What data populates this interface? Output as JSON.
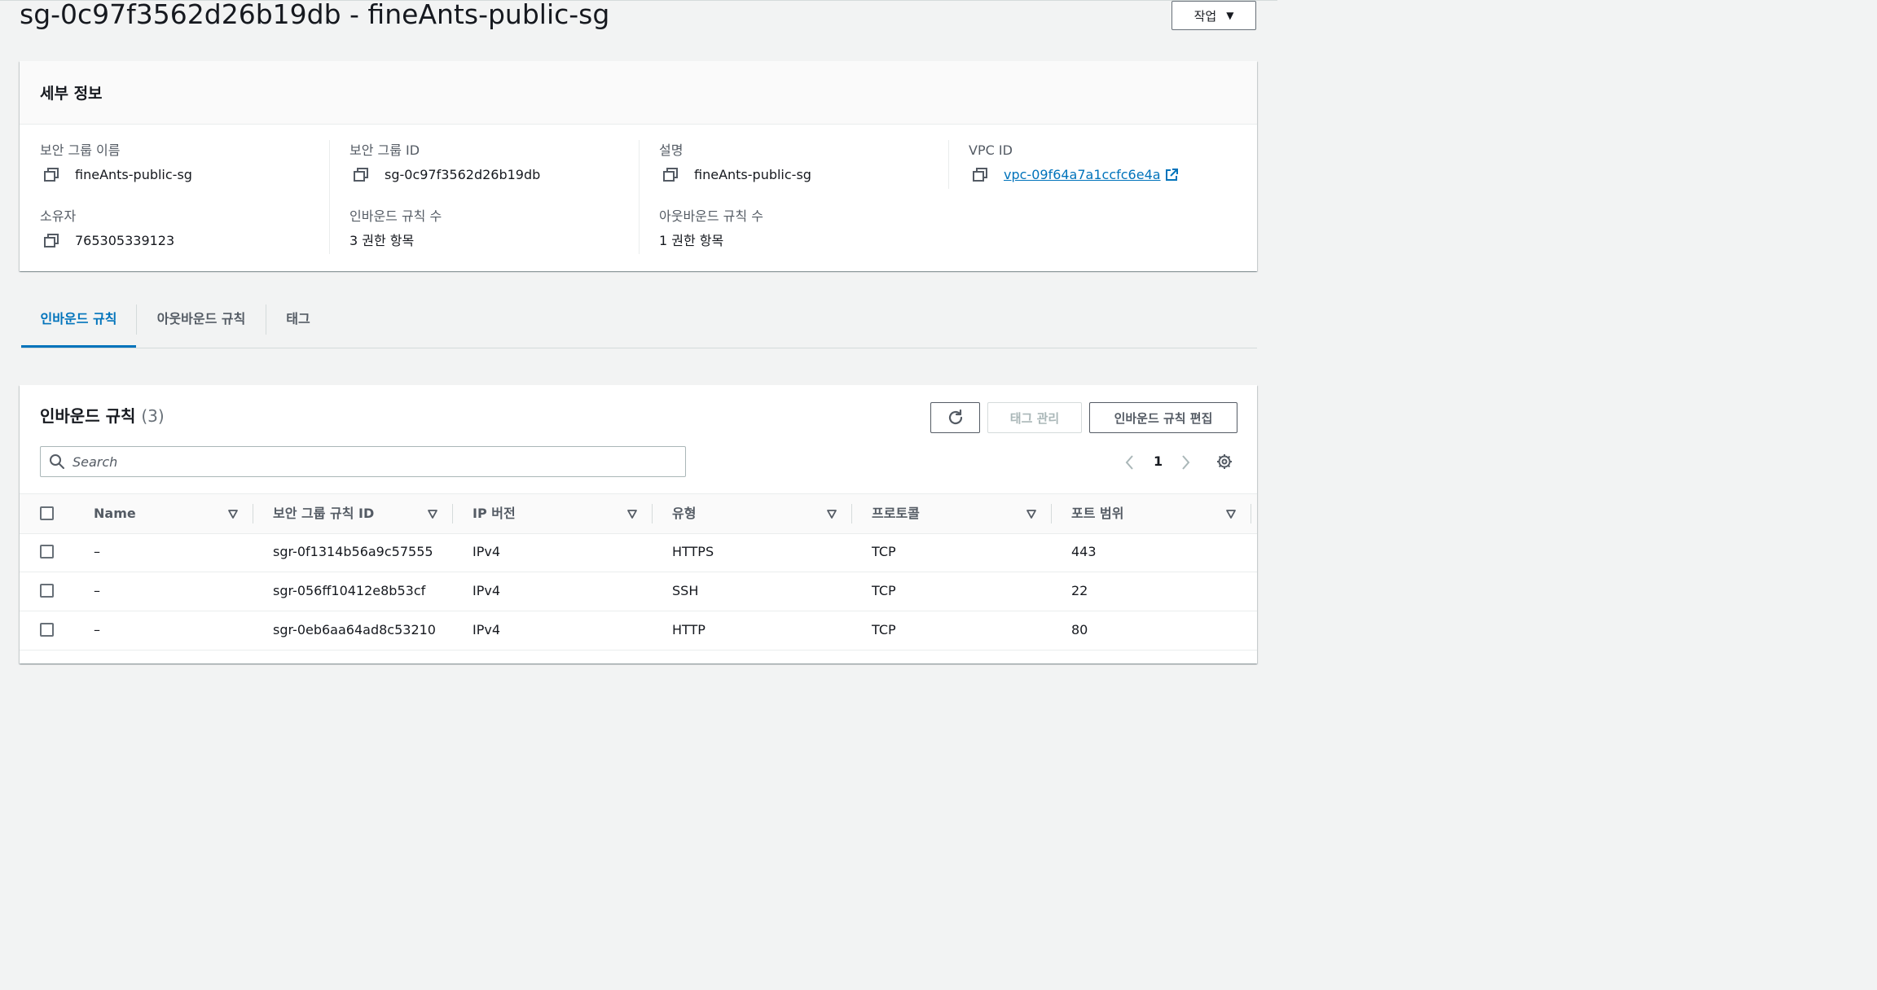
{
  "header": {
    "title": "sg-0c97f3562d26b19db - fineAnts-public-sg",
    "actions_label": "작업"
  },
  "details": {
    "title": "세부 정보",
    "security_group_name": {
      "label": "보안 그룹 이름",
      "value": "fineAnts-public-sg"
    },
    "security_group_id": {
      "label": "보안 그룹 ID",
      "value": "sg-0c97f3562d26b19db"
    },
    "description": {
      "label": "설명",
      "value": "fineAnts-public-sg"
    },
    "vpc_id": {
      "label": "VPC ID",
      "value": "vpc-09f64a7a1ccfc6e4a"
    },
    "owner": {
      "label": "소유자",
      "value": "765305339123"
    },
    "inbound_count": {
      "label": "인바운드 규칙 수",
      "value": "3 권한 항목"
    },
    "outbound_count": {
      "label": "아웃바운드 규칙 수",
      "value": "1 권한 항목"
    }
  },
  "tabs": [
    {
      "label": "인바운드 규칙",
      "active": true
    },
    {
      "label": "아웃바운드 규칙",
      "active": false
    },
    {
      "label": "태그",
      "active": false
    }
  ],
  "rules": {
    "title": "인바운드 규칙",
    "count": "(3)",
    "manage_tags_label": "태그 관리",
    "edit_label": "인바운드 규칙 편집",
    "search_placeholder": "Search",
    "page": "1",
    "columns": [
      "Name",
      "보안 그룹 규칙 ID",
      "IP 버전",
      "유형",
      "프로토콜",
      "포트 범위"
    ],
    "rows": [
      {
        "name": "–",
        "rule_id": "sgr-0f1314b56a9c57555",
        "ip_version": "IPv4",
        "type": "HTTPS",
        "protocol": "TCP",
        "port": "443"
      },
      {
        "name": "–",
        "rule_id": "sgr-056ff10412e8b53cf",
        "ip_version": "IPv4",
        "type": "SSH",
        "protocol": "TCP",
        "port": "22"
      },
      {
        "name": "–",
        "rule_id": "sgr-0eb6aa64ad8c53210",
        "ip_version": "IPv4",
        "type": "HTTP",
        "protocol": "TCP",
        "port": "80"
      }
    ]
  },
  "colors": {
    "accent": "#0073bb",
    "text": "#16191f",
    "muted": "#545b64",
    "background": "#f2f3f3"
  }
}
